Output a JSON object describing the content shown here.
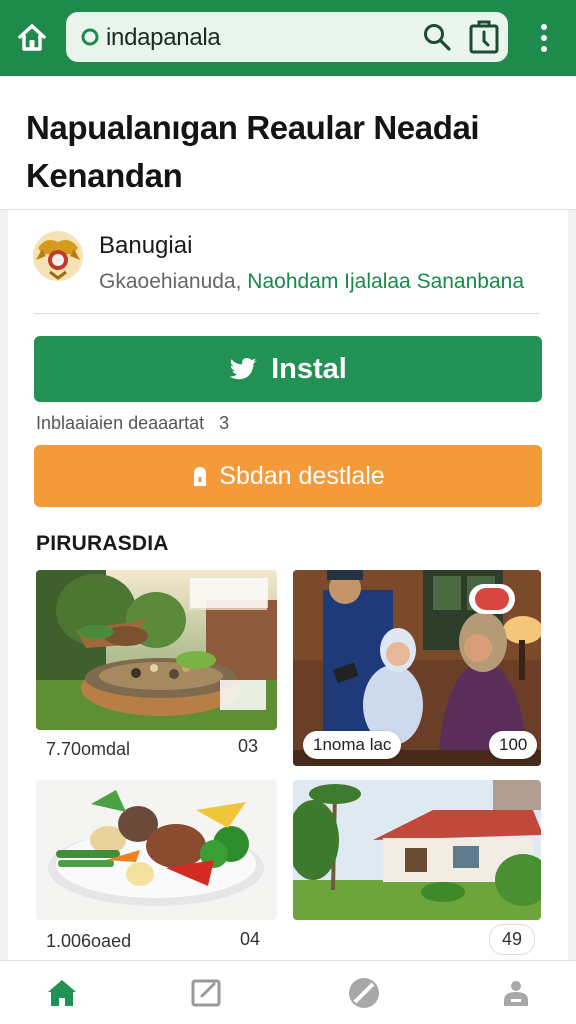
{
  "browser": {
    "url": "indapanala",
    "icons": [
      "home-icon",
      "site-icon",
      "search-icon",
      "tab-icon",
      "more-vert-icon"
    ]
  },
  "page": {
    "title": "Napualanıgan Reaular Neadai Kenandan"
  },
  "app": {
    "name": "Banugiai",
    "desc_prefix": "Gkaoehianuda,",
    "desc_highlight": "Naohdam Ijalalaa Sananbana",
    "install_label": "Instal",
    "download_info": "Inblaaiaien deaaartat",
    "download_count": "3",
    "alt_label": "Sbdan destlale"
  },
  "section": {
    "title": "PIRURASDIA"
  },
  "gallery": [
    {
      "caption": "7.70omdal",
      "count": "03"
    },
    {
      "caption": "1noma lac",
      "count": "100"
    },
    {
      "caption": "1.006oaed",
      "count": "04"
    },
    {
      "caption": "",
      "count": "49"
    }
  ],
  "nav": [
    "home-icon",
    "edit-icon",
    "compass-icon",
    "account-icon"
  ],
  "colors": {
    "primary_green": "#1e8a4c",
    "install_green": "#219253",
    "orange": "#f49a3a",
    "link_green": "#188a48"
  }
}
